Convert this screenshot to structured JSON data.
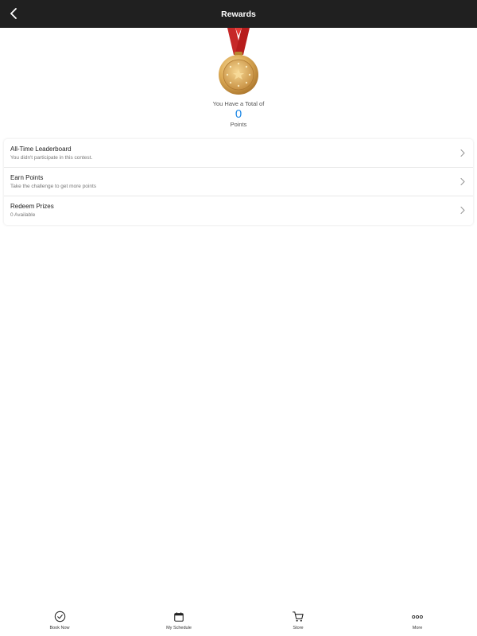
{
  "header": {
    "title": "Rewards",
    "back_icon": "chevron-left-icon"
  },
  "hero": {
    "medal_icon": "medal-icon",
    "total_label": "You Have a Total of",
    "points_value": "0",
    "points_label": "Points"
  },
  "list": {
    "items": [
      {
        "title": "All-Time Leaderboard",
        "subtitle": "You didn't participate in this contest."
      },
      {
        "title": "Earn Points",
        "subtitle": "Take the challenge to get more points"
      },
      {
        "title": "Redeem Prizes",
        "subtitle": "0 Available"
      }
    ]
  },
  "tabbar": {
    "tabs": [
      {
        "label": "Book Now",
        "icon": "check-circle-icon"
      },
      {
        "label": "My Schedule",
        "icon": "calendar-icon"
      },
      {
        "label": "Store",
        "icon": "cart-icon"
      },
      {
        "label": "More",
        "icon": "more-dots-icon"
      }
    ]
  },
  "colors": {
    "header_bg": "#202020",
    "points_accent": "#1e88e5",
    "ribbon": "#c62828",
    "medal_gold": "#d4a24c"
  }
}
